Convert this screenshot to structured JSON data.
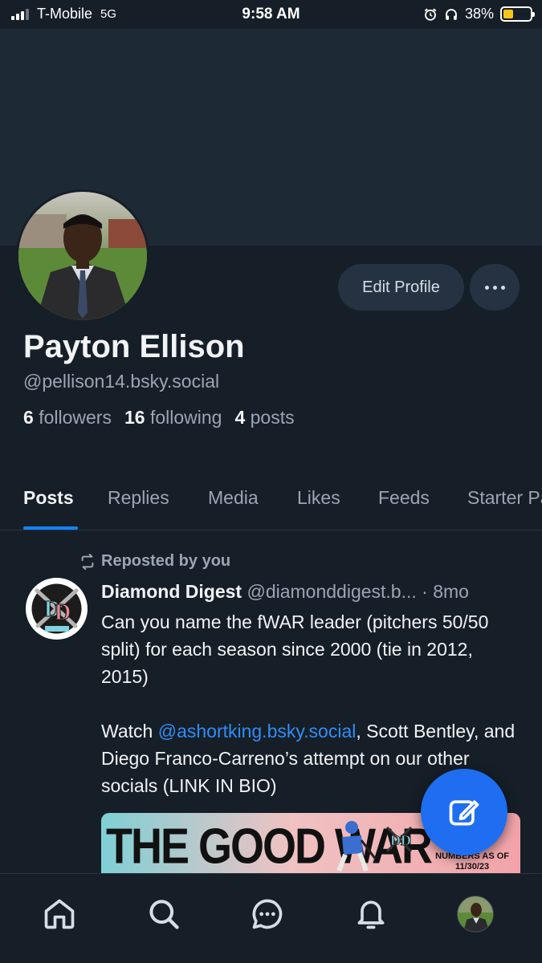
{
  "status_bar": {
    "carrier": "T-Mobile",
    "network": "5G",
    "time": "9:58 AM",
    "battery_percent": "38%",
    "battery_level": 0.38,
    "icons": [
      "alarm-icon",
      "headphones-icon",
      "battery-icon"
    ]
  },
  "profile": {
    "display_name": "Payton Ellison",
    "handle": "@pellison14.bsky.social",
    "edit_label": "Edit Profile",
    "followers_count": "6",
    "followers_label": "followers",
    "following_count": "16",
    "following_label": "following",
    "posts_count": "4",
    "posts_label": "posts"
  },
  "tabs": [
    {
      "label": "Posts",
      "active": true
    },
    {
      "label": "Replies",
      "active": false
    },
    {
      "label": "Media",
      "active": false
    },
    {
      "label": "Likes",
      "active": false
    },
    {
      "label": "Feeds",
      "active": false
    },
    {
      "label": "Starter Packs",
      "active": false
    }
  ],
  "post": {
    "repost_label": "Reposted by you",
    "author": "Diamond Digest",
    "author_handle": "@diamonddigest.b...",
    "separator": "·",
    "time": "8mo",
    "text_1": "Can you name the fWAR leader (pitchers 50/50 split) for each season since 2000 (tie in 2012, 2015)",
    "text_2_prefix": "Watch ",
    "text_2_mention": "@ashortking.bsky.social",
    "text_2_suffix": ", Scott Bentley, and Diego Franco-Carreno’s attempt on our other socials (LINK IN BIO)",
    "image_title": "THE GOOD WAR",
    "image_sub_1": "NUMBERS AS OF",
    "image_sub_2": "11/30/23"
  },
  "bottom_nav": [
    "home-icon",
    "search-icon",
    "chat-icon",
    "bell-icon",
    "profile-avatar"
  ],
  "colors": {
    "background": "#161e27",
    "banner": "#1e2936",
    "accent": "#1185fe",
    "fab": "#1f6ef2",
    "muted_text": "#9aa6b4"
  }
}
